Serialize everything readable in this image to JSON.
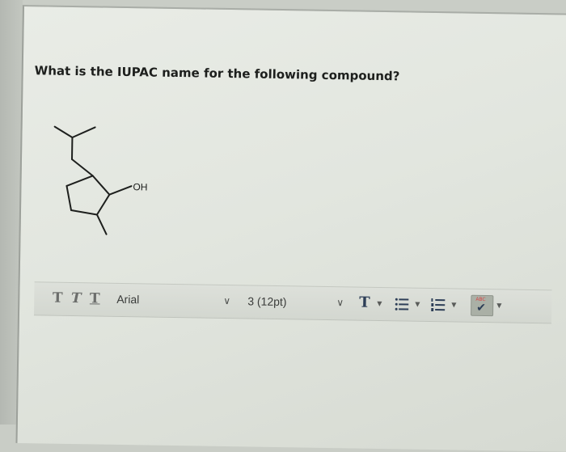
{
  "question": {
    "text": "What is the IUPAC name for the following compound?"
  },
  "structure": {
    "oh_label": "OH"
  },
  "toolbar": {
    "bold_label": "T",
    "italic_label": "T",
    "underline_label": "T",
    "font_family": "Arial",
    "font_size": "3 (12pt)",
    "font_color_label": "T",
    "spellcheck_label": "ABC",
    "icons": {
      "font_chevron": "chevron-down-icon",
      "size_chevron": "chevron-down-icon",
      "text_color": "text-color-icon",
      "unordered_list": "unordered-list-icon",
      "ordered_list": "ordered-list-icon",
      "spellcheck": "spellcheck-icon"
    }
  },
  "colors": {
    "panel": "#e6e9e3",
    "toolbar": "#d8dbd5",
    "icon_blue": "#2d3e57"
  }
}
